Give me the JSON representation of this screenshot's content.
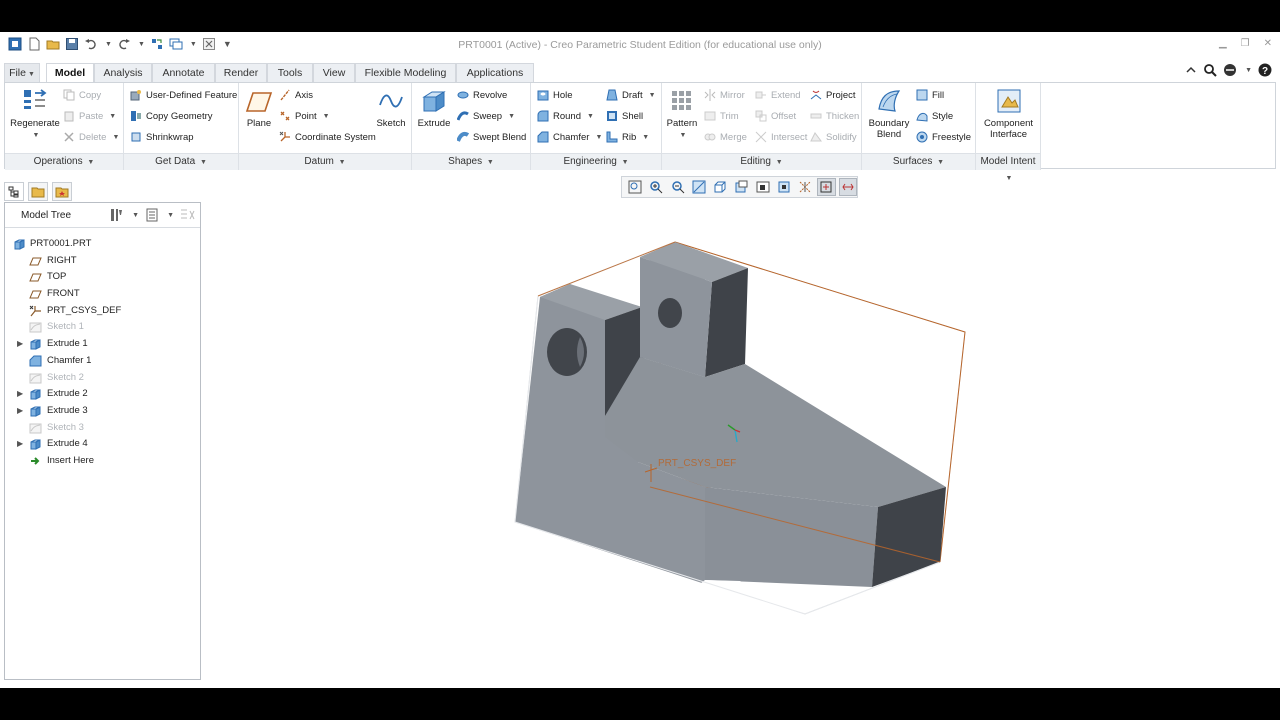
{
  "window": {
    "title": "PRT0001 (Active) - Creo Parametric Student Edition (for educational use only)"
  },
  "tabs": [
    {
      "label": "File"
    },
    {
      "label": "Model"
    },
    {
      "label": "Analysis"
    },
    {
      "label": "Annotate"
    },
    {
      "label": "Render"
    },
    {
      "label": "Tools"
    },
    {
      "label": "View"
    },
    {
      "label": "Flexible Modeling"
    },
    {
      "label": "Applications"
    }
  ],
  "ribbon": {
    "operations": {
      "regenerate": "Regenerate",
      "copy": "Copy",
      "paste": "Paste",
      "delete": "Delete",
      "footer": "Operations"
    },
    "get_data": {
      "udf": "User-Defined Feature",
      "copy_geometry": "Copy Geometry",
      "shrinkwrap": "Shrinkwrap",
      "footer": "Get Data"
    },
    "datum": {
      "plane": "Plane",
      "axis": "Axis",
      "point": "Point",
      "csys": "Coordinate System",
      "sketch": "Sketch",
      "footer": "Datum"
    },
    "shapes": {
      "extrude": "Extrude",
      "revolve": "Revolve",
      "sweep": "Sweep",
      "swept_blend": "Swept Blend",
      "footer": "Shapes"
    },
    "engineering": {
      "hole": "Hole",
      "round": "Round",
      "chamfer": "Chamfer",
      "draft": "Draft",
      "shell": "Shell",
      "rib": "Rib",
      "footer": "Engineering"
    },
    "editing": {
      "pattern": "Pattern",
      "mirror": "Mirror",
      "trim": "Trim",
      "merge": "Merge",
      "extend": "Extend",
      "offset": "Offset",
      "intersect": "Intersect",
      "project": "Project",
      "thicken": "Thicken",
      "solidify": "Solidify",
      "footer": "Editing"
    },
    "surfaces": {
      "boundary_blend": "Boundary Blend",
      "fill": "Fill",
      "style": "Style",
      "freestyle": "Freestyle",
      "footer": "Surfaces"
    },
    "model_intent": {
      "component_interface": "Component Interface",
      "footer": "Model Intent"
    }
  },
  "model_tree": {
    "title": "Model Tree",
    "items": [
      {
        "label": "PRT0001.PRT",
        "icon": "part-icon"
      },
      {
        "label": "RIGHT",
        "icon": "datum-plane-icon"
      },
      {
        "label": "TOP",
        "icon": "datum-plane-icon"
      },
      {
        "label": "FRONT",
        "icon": "datum-plane-icon"
      },
      {
        "label": "PRT_CSYS_DEF",
        "icon": "csys-icon"
      },
      {
        "label": "Sketch 1",
        "icon": "sketch-icon"
      },
      {
        "label": "Extrude 1",
        "icon": "extrude-icon"
      },
      {
        "label": "Chamfer 1",
        "icon": "chamfer-icon"
      },
      {
        "label": "Sketch 2",
        "icon": "sketch-icon"
      },
      {
        "label": "Extrude 2",
        "icon": "extrude-icon"
      },
      {
        "label": "Extrude 3",
        "icon": "extrude-icon"
      },
      {
        "label": "Sketch 3",
        "icon": "sketch-icon"
      },
      {
        "label": "Extrude 4",
        "icon": "extrude-icon"
      },
      {
        "label": "Insert Here",
        "icon": "insert-arrow-icon"
      }
    ]
  },
  "graphics": {
    "csys_label": "PRT_CSYS_DEF"
  },
  "colors": {
    "accent": "#2f6fb3",
    "model_face": "#8d939b",
    "model_dark": "#3e4248",
    "datum_orange": "#b8652a"
  }
}
